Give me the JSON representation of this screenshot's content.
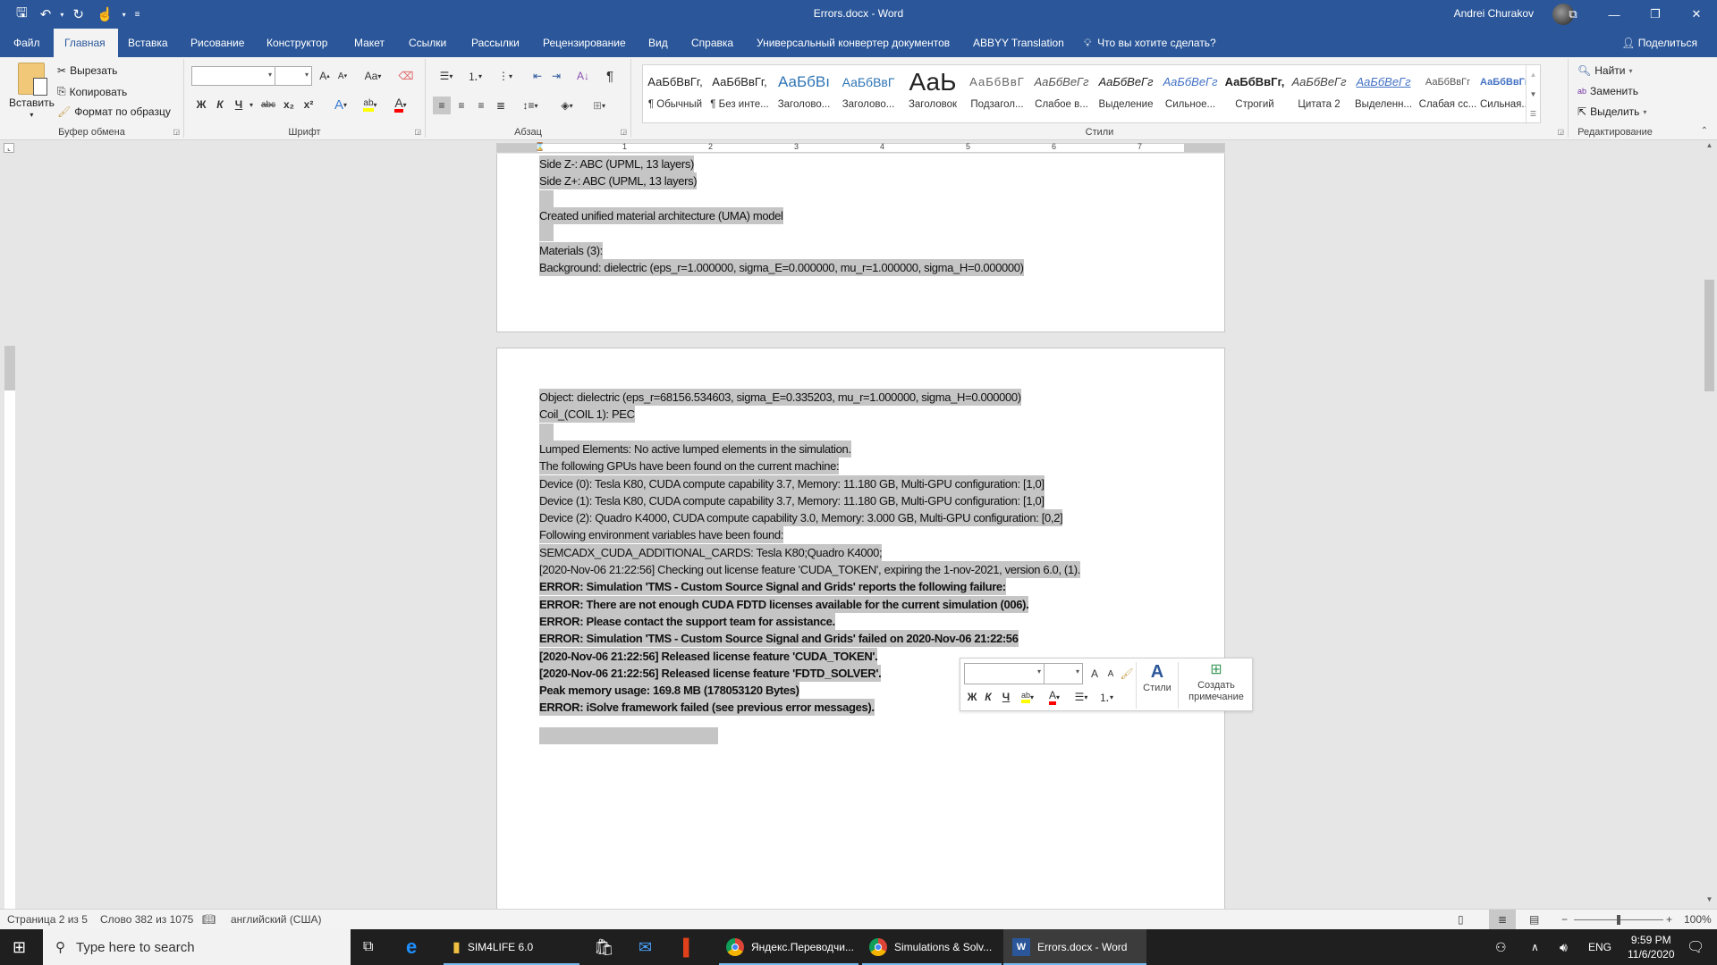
{
  "window": {
    "title": "Errors.docx  -  Word",
    "user_name": "Andrei Churakov",
    "icons": [
      "save-icon",
      "undo-icon",
      "redo-icon",
      "touch-mode-icon",
      "customize-qat-icon"
    ],
    "controls": {
      "ribbon_display": "⧉",
      "minimize": "—",
      "restore": "❐",
      "close": "✕"
    }
  },
  "tabs": [
    {
      "label": "Файл",
      "active": false
    },
    {
      "label": "Главная",
      "active": true
    },
    {
      "label": "Вставка",
      "active": false
    },
    {
      "label": "Рисование",
      "active": false
    },
    {
      "label": "Конструктор",
      "active": false
    },
    {
      "label": "Макет",
      "active": false
    },
    {
      "label": "Ссылки",
      "active": false
    },
    {
      "label": "Рассылки",
      "active": false
    },
    {
      "label": "Рецензирование",
      "active": false
    },
    {
      "label": "Вид",
      "active": false
    },
    {
      "label": "Справка",
      "active": false
    },
    {
      "label": "Универсальный конвертер документов",
      "active": false
    },
    {
      "label": "ABBYY Translation",
      "active": false
    }
  ],
  "tell_me": "Что вы хотите сделать?",
  "share_label": "Поделиться",
  "ribbon": {
    "clipboard": {
      "label": "Буфер обмена",
      "paste": "Вставить",
      "cut": "Вырезать",
      "copy": "Копировать",
      "format_painter": "Формат по образцу"
    },
    "font": {
      "label": "Шрифт",
      "font_name": "",
      "font_size": "",
      "bold": "Ж",
      "italic": "К",
      "underline": "Ч",
      "strike": "abc",
      "subscript": "x₂",
      "superscript": "x²",
      "change_case": "Aa",
      "highlight_color": "#ffff00",
      "font_color": "#ff0000"
    },
    "paragraph": {
      "label": "Абзац"
    },
    "styles": {
      "label": "Стили",
      "items": [
        {
          "preview": "АаБбВвГг,",
          "name": "¶ Обычный"
        },
        {
          "preview": "АаБбВвГг,",
          "name": "¶ Без инте..."
        },
        {
          "preview": "АаБбВı",
          "name": "Заголово..."
        },
        {
          "preview": "АаБбВвГ",
          "name": "Заголово..."
        },
        {
          "preview": "АаЬ",
          "name": "Заголовок"
        },
        {
          "preview": "АаБбВвГ",
          "name": "Подзагол..."
        },
        {
          "preview": "АаБбВеГг",
          "name": "Слабое в..."
        },
        {
          "preview": "АаБбВеГг",
          "name": "Выделение"
        },
        {
          "preview": "АаБбВеГг",
          "name": "Сильное..."
        },
        {
          "preview": "АаБбВвГг,",
          "name": "Строгий"
        },
        {
          "preview": "АаБбВеГг",
          "name": "Цитата 2"
        },
        {
          "preview": "АаБбВеГг",
          "name": "Выделенн..."
        },
        {
          "preview": "АаБбВвГг",
          "name": "Слабая сс..."
        },
        {
          "preview": "АаБбВвГг,",
          "name": "Сильная..."
        }
      ]
    },
    "editing": {
      "label": "Редактирование",
      "find": "Найти",
      "replace": "Заменить",
      "select": "Выделить"
    }
  },
  "ruler": {
    "numbers": [
      "1",
      "2",
      "3",
      "4",
      "5",
      "6",
      "7"
    ]
  },
  "document": {
    "page1_lines": [
      {
        "text": "Side Z-: ABC (UPML, 13 layers)",
        "bold": false
      },
      {
        "text": "Side Z+: ABC (UPML, 13 layers)",
        "bold": false
      },
      {
        "text": "",
        "bold": false
      },
      {
        "text": "Created unified material architecture (UMA) model",
        "bold": false
      },
      {
        "text": "",
        "bold": false
      },
      {
        "text": "Materials (3):",
        "bold": false
      },
      {
        "text": " Background: dielectric (eps_r=1.000000, sigma_E=0.000000, mu_r=1.000000, sigma_H=0.000000)",
        "bold": false
      }
    ],
    "page2_lines": [
      {
        "text": " Object: dielectric (eps_r=68156.534603, sigma_E=0.335203, mu_r=1.000000, sigma_H=0.000000)",
        "bold": false
      },
      {
        "text": " Coil_(COIL 1): PEC",
        "bold": false
      },
      {
        "text": "",
        "bold": false
      },
      {
        "text": "Lumped Elements: No active lumped elements in the simulation.",
        "bold": false
      },
      {
        "text": "The following GPUs have been found on the current machine:",
        "bold": false
      },
      {
        "text": "Device (0): Tesla K80, CUDA compute capability 3.7, Memory: 11.180 GB, Multi-GPU configuration: [1,0]",
        "bold": false
      },
      {
        "text": "Device (1): Tesla K80, CUDA compute capability 3.7, Memory: 11.180 GB, Multi-GPU configuration: [1,0]",
        "bold": false
      },
      {
        "text": "Device (2): Quadro K4000, CUDA compute capability 3.0, Memory: 3.000 GB, Multi-GPU configuration: [0,2]",
        "bold": false
      },
      {
        "text": "Following environment variables have been found:",
        "bold": false
      },
      {
        "text": "SEMCADX_CUDA_ADDITIONAL_CARDS: Tesla K80;Quadro K4000;",
        "bold": false
      },
      {
        "text": "[2020-Nov-06 21:22:56] Checking out license feature 'CUDA_TOKEN', expiring the 1-nov-2021, version 6.0, (1).",
        "bold": false
      },
      {
        "text": "ERROR: Simulation 'TMS - Custom Source Signal and Grids' reports the following failure:",
        "bold": true
      },
      {
        "text": "ERROR: There are not enough CUDA FDTD licenses available for the current simulation (006).",
        "bold": true
      },
      {
        "text": "ERROR:  Please contact the support team for assistance.",
        "bold": true
      },
      {
        "text": "ERROR: Simulation 'TMS - Custom Source Signal and Grids' failed on 2020-Nov-06 21:22:56",
        "bold": true
      },
      {
        "text": "[2020-Nov-06 21:22:56] Released license feature 'CUDA_TOKEN'.",
        "bold": true
      },
      {
        "text": "[2020-Nov-06 21:22:56] Released license feature 'FDTD_SOLVER'.",
        "bold": true
      },
      {
        "text": "Peak memory usage: 169.8 MB (178053120 Bytes)",
        "bold": true
      },
      {
        "text": "ERROR: iSolve framework failed (see previous error messages).",
        "bold": true
      }
    ]
  },
  "mini_toolbar": {
    "styles": "Стили",
    "new_comment_line1": "Создать",
    "new_comment_line2": "примечание"
  },
  "statusbar": {
    "page": "Страница 2 из 5",
    "words": "Слово 382 из 1075",
    "language": "английский (США)",
    "zoom": "100%",
    "zoom_level_percent": 100
  },
  "taskbar": {
    "search_placeholder": "Type here to search",
    "apps": [
      {
        "label": "SIM4LIFE 6.0",
        "icon": "folder-icon"
      },
      {
        "label": "Яндекс.Переводчи...",
        "icon": "chrome-icon"
      },
      {
        "label": "Simulations & Solv...",
        "icon": "chrome-icon"
      },
      {
        "label": "Errors.docx - Word",
        "icon": "word-icon"
      }
    ],
    "lang": "ENG",
    "time": "9:59 PM",
    "date": "11/6/2020"
  }
}
